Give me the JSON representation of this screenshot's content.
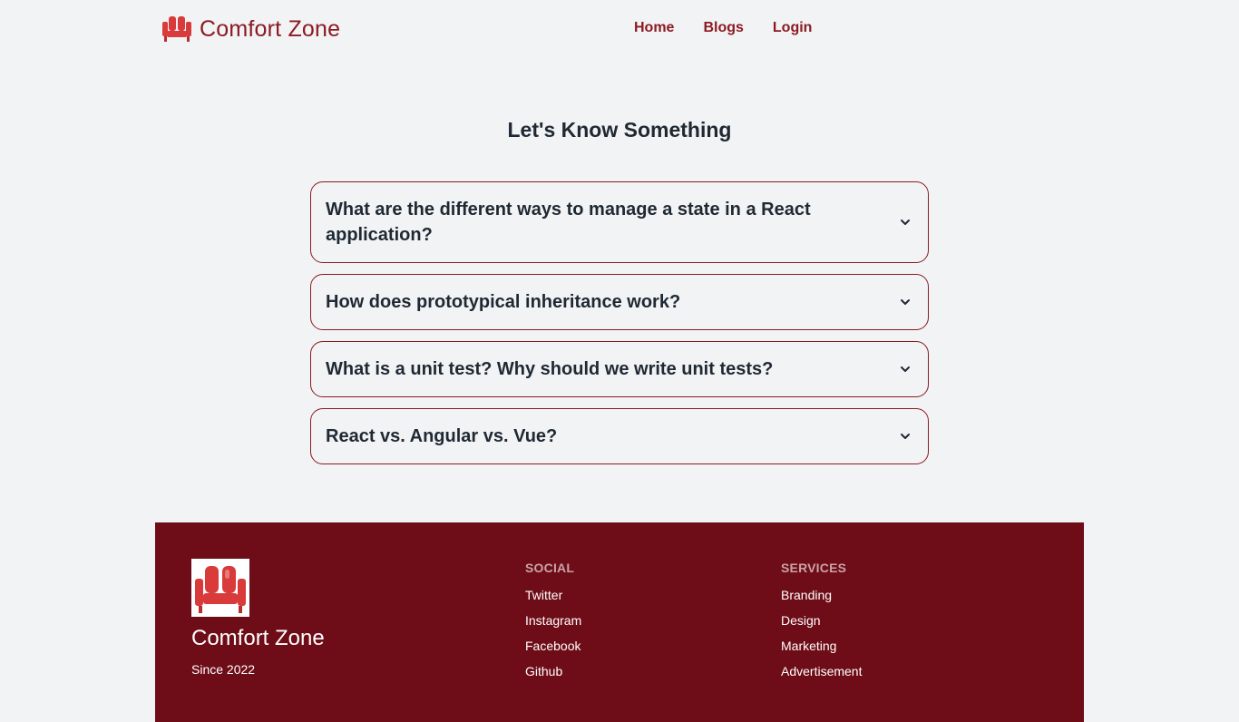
{
  "header": {
    "brand_name": "Comfort Zone",
    "nav": [
      {
        "label": "Home"
      },
      {
        "label": "Blogs"
      },
      {
        "label": "Login"
      }
    ]
  },
  "main": {
    "title": "Let's Know Something",
    "faqs": [
      {
        "question": "What are the different ways to manage a state in a React application?"
      },
      {
        "question": "How does prototypical inheritance work?"
      },
      {
        "question": "What is a unit test? Why should we write unit tests?"
      },
      {
        "question": "React vs. Angular vs. Vue?"
      }
    ]
  },
  "footer": {
    "brand_name": "Comfort Zone",
    "since": "Since 2022",
    "social": {
      "heading": "SOCIAL",
      "links": [
        "Twitter",
        "Instagram",
        "Facebook",
        "Github"
      ]
    },
    "services": {
      "heading": "SERVICES",
      "links": [
        "Branding",
        "Design",
        "Marketing",
        "Advertisement"
      ]
    }
  },
  "colors": {
    "brand": "#8c1a22",
    "footer_bg": "#6e0c17",
    "page_bg": "#f2f3f5",
    "icon_red": "#d93a3a"
  },
  "icons": {
    "brand": "armchair-icon",
    "faq_toggle": "chevron-down-icon"
  }
}
